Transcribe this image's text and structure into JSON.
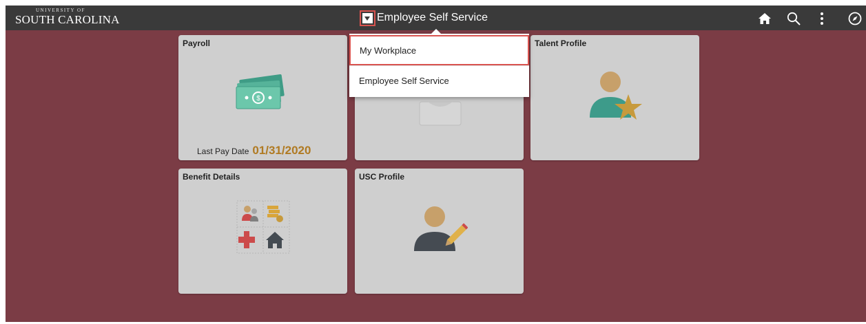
{
  "header": {
    "logo_line1": "UNIVERSITY OF",
    "logo_line2": "SOUTH CAROLINA",
    "title": "Employee Self Service",
    "icons": [
      "home-icon",
      "search-icon",
      "actions-menu-icon",
      "navbar-compass-icon"
    ]
  },
  "dropdown": {
    "items": [
      {
        "label": "My Workplace",
        "selected": true
      },
      {
        "label": "Employee Self Service",
        "selected": false
      }
    ]
  },
  "tiles": [
    {
      "title": "Payroll",
      "icon": "money-icon",
      "pay_date_label": "Last Pay Date",
      "pay_date": "01/31/2020"
    },
    {
      "title": "",
      "icon": "obscured-tile-icon"
    },
    {
      "title": "Talent Profile",
      "icon": "talent-profile-icon"
    },
    {
      "title": "Benefit Details",
      "icon": "benefit-details-icon"
    },
    {
      "title": "USC Profile",
      "icon": "usc-profile-icon"
    }
  ],
  "colors": {
    "background": "#7b3c45",
    "topbar": "#3a3a3a",
    "tile": "#cfcfcf",
    "accent_date": "#b07a22",
    "highlight": "#d9534f"
  }
}
